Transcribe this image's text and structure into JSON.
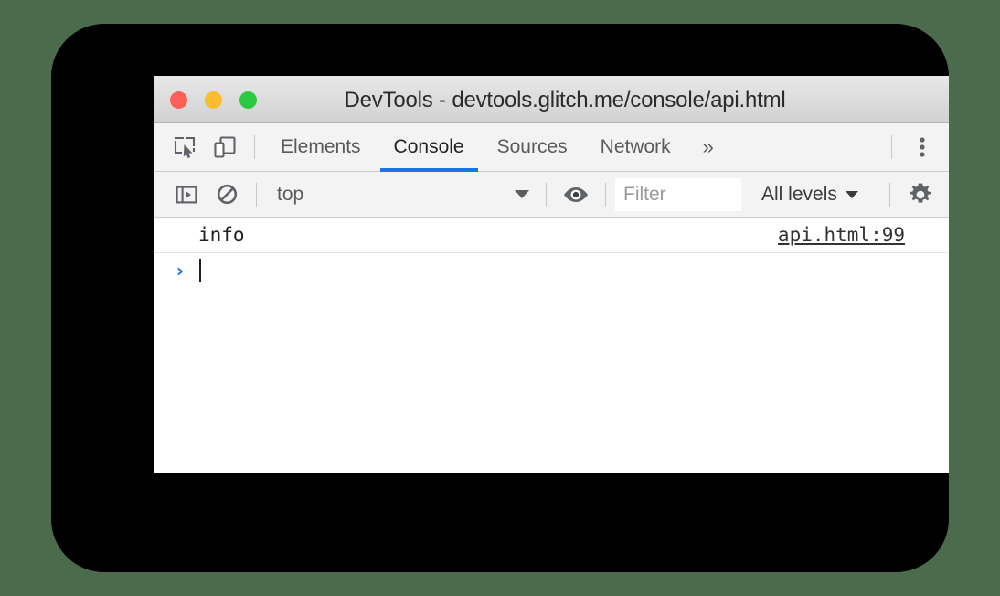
{
  "window": {
    "title": "DevTools - devtools.glitch.me/console/api.html",
    "traffic_lights": [
      {
        "name": "close",
        "color": "#fc5f57"
      },
      {
        "name": "minimize",
        "color": "#fdbc2e"
      },
      {
        "name": "maximize",
        "color": "#2bc941"
      }
    ]
  },
  "tab_bar": {
    "inspect_icon": "inspect-element-icon",
    "device_icon": "device-toolbar-icon",
    "tabs": [
      {
        "label": "Elements",
        "active": false
      },
      {
        "label": "Console",
        "active": true
      },
      {
        "label": "Sources",
        "active": false
      },
      {
        "label": "Network",
        "active": false
      }
    ],
    "more_tabs_label": "»",
    "kebab_icon": "more-options-icon",
    "active_underline_color": "#1a73e8"
  },
  "console_toolbar": {
    "sidebar_icon": "console-sidebar-icon",
    "clear_icon": "clear-console-icon",
    "context": {
      "value": "top",
      "caret": "chevron-down-icon"
    },
    "eye_icon": "live-expression-eye-icon",
    "filter": {
      "value": "",
      "placeholder": "Filter"
    },
    "levels": {
      "label": "All levels",
      "caret": "chevron-down-icon"
    },
    "settings_icon": "settings-gear-icon"
  },
  "console": {
    "messages": [
      {
        "text": "info",
        "source": "api.html:99"
      }
    ],
    "prompt": {
      "chevron": "›",
      "value": ""
    }
  },
  "colors": {
    "desktop_background": "#4b6b4c",
    "frame": "#000000",
    "toolbar_background": "#f3f3f3",
    "accent_blue": "#1a73e8"
  }
}
